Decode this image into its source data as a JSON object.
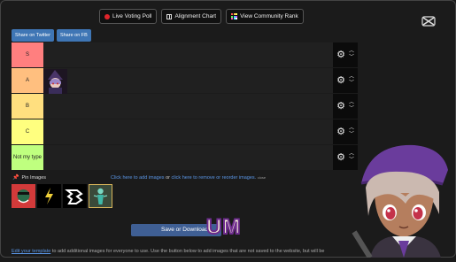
{
  "toolbar": {
    "live_poll": "Live Voting Poll",
    "alignment": "Alignment Chart",
    "community": "View Community Rank"
  },
  "share": {
    "twitter": "Share on Twitter",
    "fb": "Share on FB"
  },
  "tiers": [
    {
      "label": "S",
      "color": "#ff7f7f"
    },
    {
      "label": "A",
      "color": "#ffbf7f"
    },
    {
      "label": "B",
      "color": "#ffdf7f"
    },
    {
      "label": "C",
      "color": "#ffff7f"
    },
    {
      "label": "Not my type",
      "color": "#bfff7f"
    }
  ],
  "pin": {
    "label": "Pin Images"
  },
  "help": {
    "link1": "Click here to add images",
    "or": "or",
    "link2": "click here to remove or reorder images.",
    "hide": "close"
  },
  "save_button": "Save or Download",
  "overlay_text": "UM",
  "footer": {
    "link": "Edit your template",
    "text": "to add additional images for everyone to use. Use the button below to add images that are not saved to the website, but will be"
  }
}
